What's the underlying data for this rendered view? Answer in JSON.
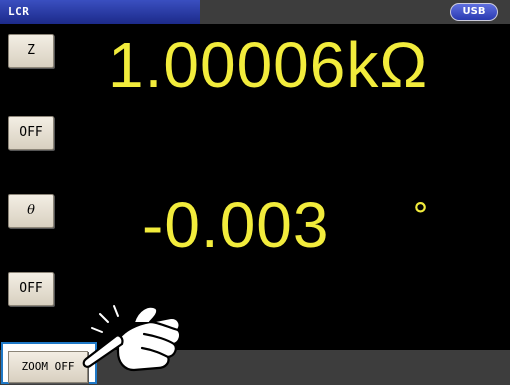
{
  "window": {
    "title": "LCR",
    "usb_badge": "USB"
  },
  "side_buttons": {
    "param1_label": "Z",
    "param1_off_label": "OFF",
    "param2_label": "θ",
    "param2_off_label": "OFF"
  },
  "readings": {
    "primary": "1.00006kΩ",
    "secondary": "-0.003",
    "secondary_unit": "°"
  },
  "bottom": {
    "zoom_label": "ZOOM OFF"
  },
  "colors": {
    "reading": "#f2ec3c",
    "highlight_frame": "#1f79c7",
    "title_tab": "#2a3ab0"
  },
  "icons": {
    "pointer": "pointing-hand-icon"
  }
}
